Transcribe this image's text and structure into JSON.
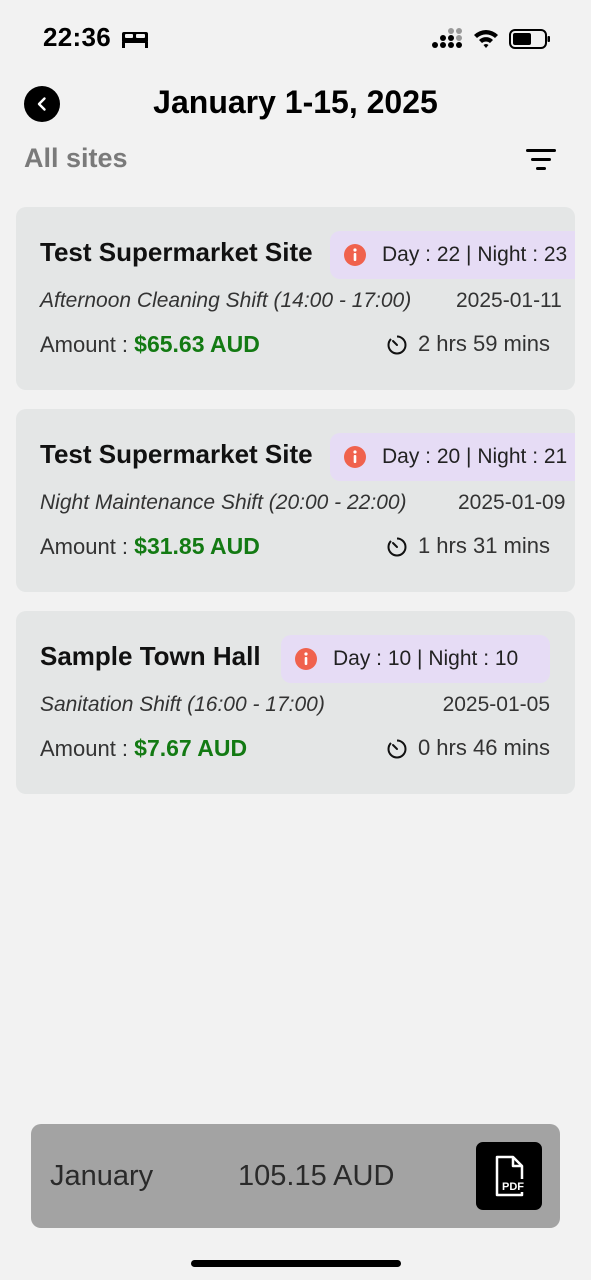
{
  "status_bar": {
    "time": "22:36"
  },
  "header": {
    "title": "January 1-15, 2025",
    "site_filter": "All sites"
  },
  "shifts": [
    {
      "site": "Test Supermarket Site",
      "badge": "Day : 22 | Night : 23",
      "shift": "Afternoon Cleaning Shift (14:00 - 17:00)",
      "date": "2025-01-11",
      "amount_label": "Amount : ",
      "amount": "$65.63 AUD",
      "duration": "2 hrs 59 mins"
    },
    {
      "site": "Test Supermarket Site",
      "badge": "Day : 20 | Night : 21",
      "shift": "Night Maintenance Shift (20:00 - 22:00)",
      "date": "2025-01-09",
      "amount_label": "Amount : ",
      "amount": "$31.85 AUD",
      "duration": "1 hrs 31 mins"
    },
    {
      "site": "Sample Town Hall",
      "badge": "Day : 10 | Night : 10",
      "shift": "Sanitation Shift (16:00 - 17:00)",
      "date": "2025-01-05",
      "amount_label": "Amount : ",
      "amount": "$7.67 AUD",
      "duration": "0 hrs 46 mins"
    }
  ],
  "summary": {
    "month": "January",
    "total": "105.15 AUD",
    "pdf_label": "PDF"
  },
  "colors": {
    "amount": "#137a13",
    "badge_bg": "#e6dcf5",
    "info_icon": "#f0624d",
    "card_bg": "#e4e6e6"
  },
  "icons": [
    "bed-icon",
    "cellular-signal-icon",
    "wifi-icon",
    "battery-icon",
    "chevron-left-icon",
    "filter-icon",
    "info-icon",
    "timer-icon",
    "pdf-file-icon"
  ]
}
